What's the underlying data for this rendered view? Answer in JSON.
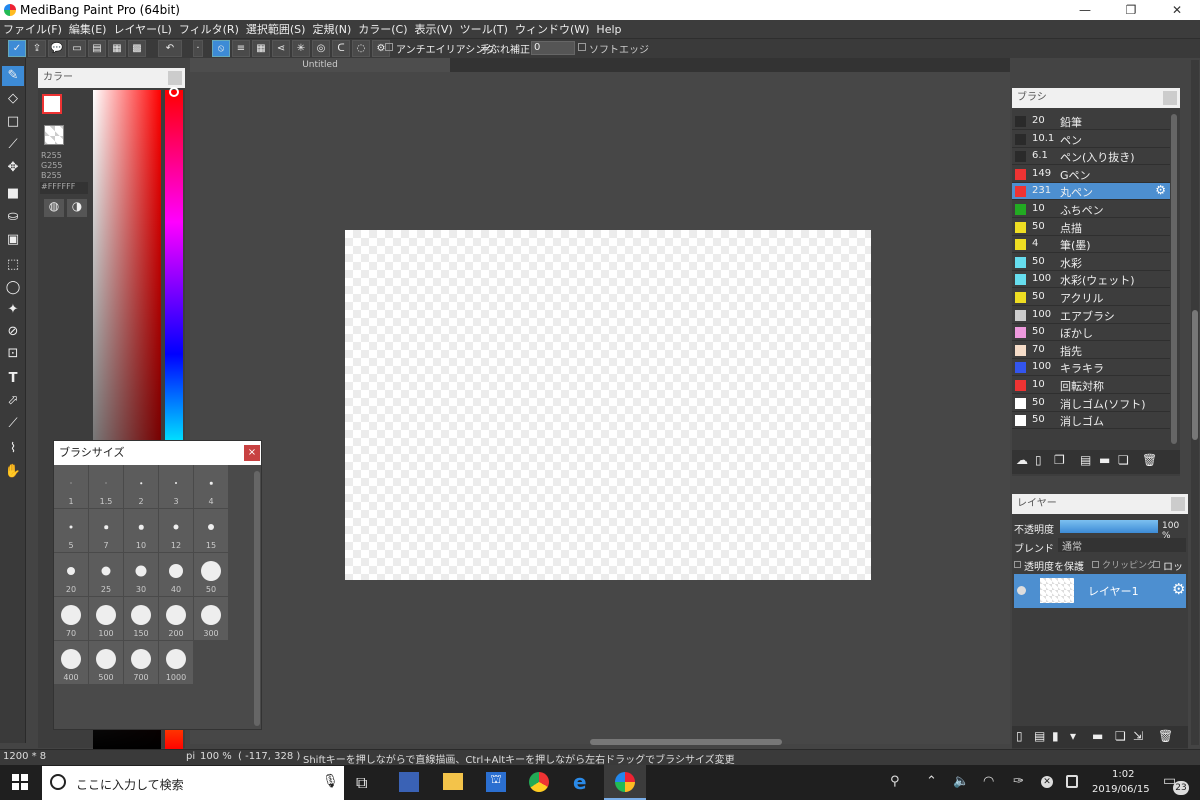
{
  "window": {
    "title": "MediBang Paint Pro (64bit)",
    "minimize": "—",
    "restore": "❐",
    "close": "✕"
  },
  "menu": [
    "ファイル(F)",
    "編集(E)",
    "レイヤー(L)",
    "フィルタ(R)",
    "選択範囲(S)",
    "定規(N)",
    "カラー(C)",
    "表示(V)",
    "ツール(T)",
    "ウィンドウ(W)",
    "Help"
  ],
  "toolbar": {
    "antialias": "アンチエイリアシング",
    "stabilizer_label": "手ぶれ補正",
    "stabilizer_value": "0",
    "softedge": "ソフトエッジ"
  },
  "document": {
    "tab_title": "Untitled"
  },
  "color_panel": {
    "title": "カラー",
    "r": "R255",
    "g": "G255",
    "b": "B255",
    "hex": "#FFFFFF"
  },
  "brush_size_panel": {
    "title": "ブラシサイズ",
    "close": "×",
    "sizes": [
      "1",
      "1.5",
      "2",
      "3",
      "4",
      "5",
      "7",
      "10",
      "12",
      "15",
      "20",
      "25",
      "30",
      "40",
      "50",
      "70",
      "100",
      "150",
      "200",
      "300",
      "400",
      "500",
      "700",
      "1000"
    ]
  },
  "brush_panel": {
    "title": "ブラシ",
    "selected_index": 4,
    "items": [
      {
        "size": "20",
        "name": "鉛筆",
        "color": "#2a2a2a"
      },
      {
        "size": "10.1",
        "name": "ペン",
        "color": "#2a2a2a"
      },
      {
        "size": "6.1",
        "name": "ペン(入り抜き)",
        "color": "#2a2a2a"
      },
      {
        "size": "149",
        "name": "Gペン",
        "color": "#ee3333"
      },
      {
        "size": "231",
        "name": "丸ペン",
        "color": "#ee3333"
      },
      {
        "size": "10",
        "name": "ふちペン",
        "color": "#22aa22"
      },
      {
        "size": "50",
        "name": "点描",
        "color": "#eedd22"
      },
      {
        "size": "4",
        "name": "筆(墨)",
        "color": "#eedd22"
      },
      {
        "size": "50",
        "name": "水彩",
        "color": "#66ddee"
      },
      {
        "size": "100",
        "name": "水彩(ウェット)",
        "color": "#66ddee"
      },
      {
        "size": "50",
        "name": "アクリル",
        "color": "#eedd22"
      },
      {
        "size": "100",
        "name": "エアブラシ",
        "color": "#cccccc"
      },
      {
        "size": "50",
        "name": "ぼかし",
        "color": "#ee99dd"
      },
      {
        "size": "70",
        "name": "指先",
        "color": "#f5dcc8"
      },
      {
        "size": "100",
        "name": "キラキラ",
        "color": "#3355ee"
      },
      {
        "size": "10",
        "name": "回転対称",
        "color": "#ee3333"
      },
      {
        "size": "50",
        "name": "消しゴム(ソフト)",
        "color": "#ffffff"
      },
      {
        "size": "50",
        "name": "消しゴム",
        "color": "#ffffff"
      }
    ]
  },
  "layer_panel": {
    "title": "レイヤー",
    "opacity_label": "不透明度",
    "opacity_value": "100 %",
    "opacity": 1.0,
    "blend_label": "ブレンド",
    "blend_value": "通常",
    "protect": "透明度を保護",
    "clipping": "クリッピング",
    "lock": "ロック",
    "layer_name": "レイヤー1"
  },
  "status": {
    "size": "1200 * 8",
    "unit": "pi",
    "zoom": "100 %",
    "coords": "( -117, 328 )",
    "hint": "Shiftキーを押しながらで直線描画、Ctrl+Altキーを押しながら左右ドラッグでブラシサイズ変更"
  },
  "taskbar": {
    "search_placeholder": "ここに入力して検索",
    "time": "1:02",
    "date": "2019/06/15",
    "notifications": "23"
  }
}
